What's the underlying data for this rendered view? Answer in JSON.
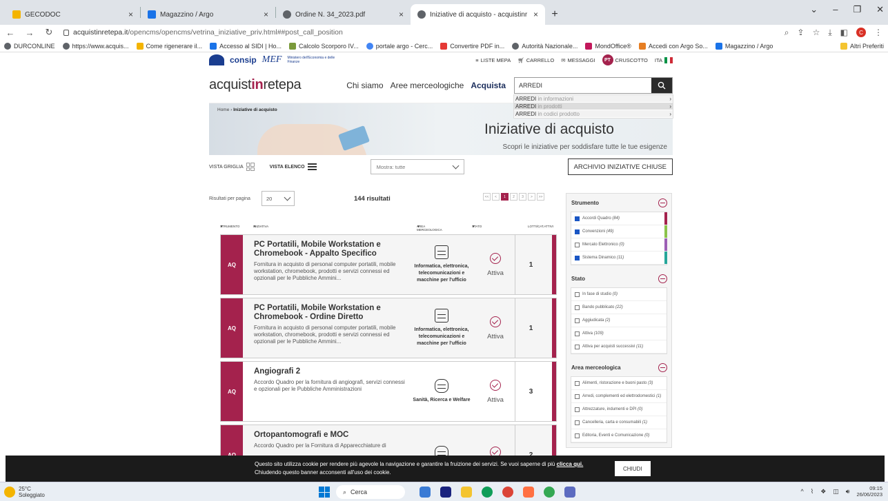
{
  "browser": {
    "tabs": [
      {
        "title": "GECODOC",
        "color": "#f4b400"
      },
      {
        "title": "Magazzino / Argo",
        "color": "#1a73e8"
      },
      {
        "title": "Ordine N. 34_2023.pdf",
        "color": "#5f6368"
      },
      {
        "title": "Iniziative di acquisto - acquistinr",
        "color": "#5f6368",
        "active": true
      }
    ],
    "url_host": "acquistinretepa.it",
    "url_path": "/opencms/opencms/vetrina_iniziative_priv.html##post_call_position",
    "profile_initial": "C",
    "bookmarks": [
      "DURCONLINE",
      "https://www.acquis...",
      "Come rigenerare il...",
      "Accesso al SIDI | Ho...",
      "Calcolo Scorporo IV...",
      "portale argo - Cerc...",
      "Convertire PDF in...",
      "Autorità Nazionale...",
      "MondOffice®",
      "Accedi con Argo So...",
      "Magazzino / Argo"
    ],
    "bookmarks_other": "Altri Preferiti"
  },
  "site": {
    "consip": "consip",
    "mef": "MEF",
    "mef_sub": "Ministero dell'Economia e delle Finanze",
    "top_links": [
      "LISTE MEPA",
      "CARRELLO",
      "MESSAGGI"
    ],
    "user_initials": "PT",
    "cruscotto": "CRUSCOTTO",
    "lang": "ITA",
    "brand_pre": "acquist",
    "brand_mid": "in",
    "brand_post": "retepa",
    "nav": [
      "Chi siamo",
      "Aree merceologiche",
      "Acquista"
    ],
    "search_value": "ARREDI",
    "suggestions": [
      {
        "term": "ARREDI",
        "scope": "in informazioni"
      },
      {
        "term": "ARREDI",
        "scope": "in prodotti"
      },
      {
        "term": "ARREDI",
        "scope": "in codici prodotto"
      }
    ],
    "breadcrumb_home": "Home",
    "breadcrumb_current": "Iniziative di acquisto",
    "hero_title": "Iniziative di acquisto",
    "hero_sub": "Scopri le iniziative per soddisfare tutte le tue esigenze",
    "vista_griglia": "VISTA GRIGLIA",
    "vista_elenco": "VISTA ELENCO",
    "mostra": "Mostra: tutte",
    "archivio": "ARCHIVIO INIZIATIVE CHIUSE",
    "per_page_label": "Risultati per pagina",
    "per_page": "20",
    "results_count": "144 risultati",
    "pages": [
      "<<",
      "<",
      "1",
      "2",
      "3",
      ">",
      ">>"
    ],
    "col_heads": [
      "STRUMENTO",
      "INIZIATIVA",
      "AREA MERCEOLOGICA",
      "STATO",
      "LOTTI/CAT.ATTIVI"
    ],
    "results": [
      {
        "badge": "AQ",
        "title": "PC Portatili, Mobile Workstation e Chromebook - Appalto Specifico",
        "desc": "Fornitura in acquisto di personal computer portatili, mobile workstation, chromebook, prodotti e servizi connessi ed opzionali per le Pubbliche Ammini...",
        "area": "Informatica, elettronica, telecomunicazioni e macchine per l'ufficio",
        "stato": "Attiva",
        "lotti": "1"
      },
      {
        "badge": "AQ",
        "title": "PC Portatili, Mobile Workstation e Chromebook - Ordine Diretto",
        "desc": "Fornitura in acquisto di personal computer portatili, mobile workstation, chromebook, prodotti e servizi connessi ed opzionali per le Pubbliche Ammini...",
        "area": "Informatica, elettronica, telecomunicazioni e macchine per l'ufficio",
        "stato": "Attiva",
        "lotti": "1"
      },
      {
        "badge": "AQ",
        "title": "Angiografi 2",
        "desc": "Accordo Quadro per la fornitura di angiografi, servizi connessi e opzionali per le Pubbliche Amministrazioni",
        "area": "Sanità, Ricerca e Welfare",
        "stato": "Attiva",
        "lotti": "3"
      },
      {
        "badge": "AQ",
        "title": "Ortopantomografi e MOC",
        "desc": "Accordo Quadro per la Fornitura di Apparecchiature di",
        "area": "",
        "stato": "",
        "lotti": "2"
      }
    ],
    "filters": {
      "strumento_title": "Strumento",
      "strumento": [
        {
          "label": "Accordi Quadro",
          "count": "(84)",
          "checked": true,
          "color": "#a4224d"
        },
        {
          "label": "Convenzioni",
          "count": "(49)",
          "checked": true,
          "color": "#8bc34a"
        },
        {
          "label": "Mercato Elettronico",
          "count": "(0)",
          "checked": false,
          "color": "#9c5fb5"
        },
        {
          "label": "Sistema Dinamico",
          "count": "(11)",
          "checked": true,
          "color": "#26a69a"
        }
      ],
      "stato_title": "Stato",
      "stato": [
        {
          "label": "In fase di studio",
          "count": "(0)"
        },
        {
          "label": "Bando pubblicato",
          "count": "(22)"
        },
        {
          "label": "Aggiudicata",
          "count": "(2)"
        },
        {
          "label": "Attiva",
          "count": "(109)"
        },
        {
          "label": "Attiva per acquisti successivi",
          "count": "(11)"
        }
      ],
      "area_title": "Area merceologica",
      "area": [
        {
          "label": "Alimenti, ristorazione e buoni pasto",
          "count": "(3)"
        },
        {
          "label": "Arredi, complementi ed elettrodomestici",
          "count": "(1)"
        },
        {
          "label": "Attrezzature, indumenti e DPI",
          "count": "(0)"
        },
        {
          "label": "Cancelleria, carta e consumabili",
          "count": "(1)"
        },
        {
          "label": "Editoria, Eventi e Comunicazione",
          "count": "(0)"
        }
      ]
    }
  },
  "cookie": {
    "text": "Questo sito utilizza cookie per rendere più agevole la navigazione e garantire la fruizione dei servizi. Se vuoi saperne di più",
    "link": "clicca qui.",
    "text2": "Chiudendo questo banner acconsenti all'uso dei cookie.",
    "button": "CHIUDI"
  },
  "taskbar": {
    "temp": "25°C",
    "weather": "Soleggiato",
    "search": "Cerca",
    "time": "09:15",
    "date": "26/06/2023"
  }
}
